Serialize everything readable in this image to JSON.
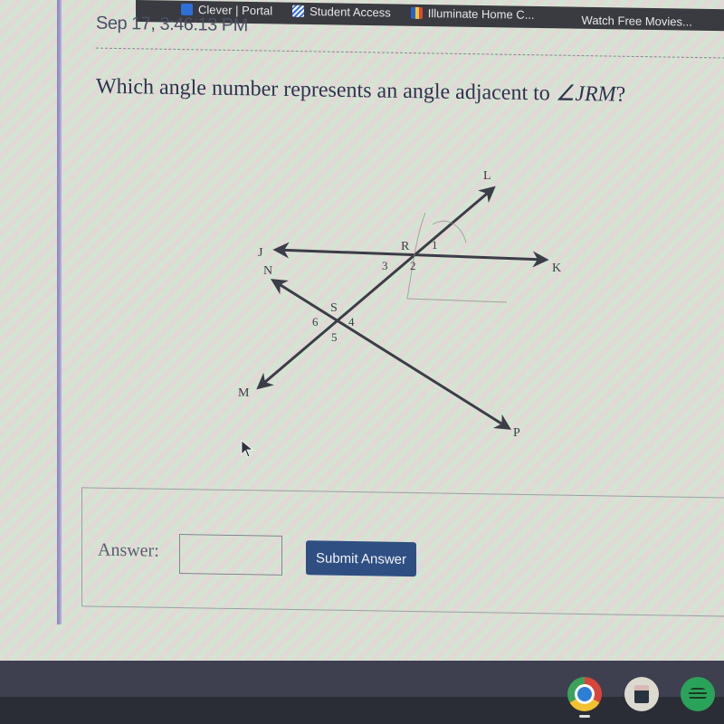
{
  "bookmarks": [
    {
      "label": "Clever | Portal",
      "icon": "clever-icon"
    },
    {
      "label": "Student Access",
      "icon": "student-access-icon"
    },
    {
      "label": "Illuminate Home C...",
      "icon": "illuminate-icon"
    },
    {
      "label": "Watch Free Movies...",
      "icon": null
    }
  ],
  "page": {
    "timestamp": "Sep 17, 3:46:13 PM",
    "question_prefix": "Which angle number represents an angle adjacent to ",
    "question_angle": "∠JRM",
    "question_suffix": "?"
  },
  "diagram": {
    "point_labels": {
      "L": "L",
      "J": "J",
      "N": "N",
      "R": "R",
      "K": "K",
      "S": "S",
      "M": "M",
      "P": "P"
    },
    "angle_labels": {
      "a1": "1",
      "a2": "2",
      "a3": "3",
      "a4": "4",
      "a5": "5",
      "a6": "6"
    },
    "lines": [
      {
        "name": "line-JK",
        "from": "J",
        "to": "K"
      },
      {
        "name": "line-LM",
        "from": "L",
        "to": "M",
        "through": [
          "R",
          "S"
        ]
      },
      {
        "name": "line-NP",
        "from": "N",
        "to": "P",
        "through": [
          "S"
        ]
      }
    ]
  },
  "answer": {
    "label": "Answer:",
    "value": "",
    "placeholder": "",
    "submit_label": "Submit Answer"
  },
  "taskbar": {
    "apps": [
      "chrome-icon",
      "calculator-icon",
      "spotify-icon"
    ]
  }
}
